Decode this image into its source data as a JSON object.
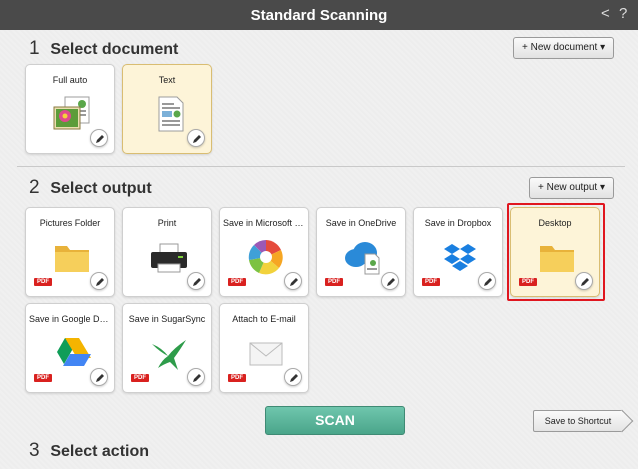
{
  "window": {
    "title": "Standard Scanning",
    "back_glyph": "<",
    "help_glyph": "?"
  },
  "section1": {
    "number": "1",
    "label": "Select document",
    "new_button": "+ New document ▾",
    "tiles": [
      {
        "label": "Full auto",
        "icon": "photo-icon",
        "selected": false
      },
      {
        "label": "Text",
        "icon": "text-document-icon",
        "selected": true
      }
    ]
  },
  "section2": {
    "number": "2",
    "label": "Select output",
    "new_button": "+ New output ▾",
    "tiles": [
      {
        "label": "Pictures Folder",
        "icon": "folder-icon",
        "badge": "PDF"
      },
      {
        "label": "Print",
        "icon": "printer-icon",
        "badge": ""
      },
      {
        "label": "Save in Microsoft S...",
        "icon": "microsoft-sharepoint-icon",
        "badge": "PDF"
      },
      {
        "label": "Save in OneDrive",
        "icon": "onedrive-icon",
        "badge": "PDF"
      },
      {
        "label": "Save in Dropbox",
        "icon": "dropbox-icon",
        "badge": "PDF"
      },
      {
        "label": "Desktop",
        "icon": "folder-icon",
        "badge": "PDF",
        "selected": true
      },
      {
        "label": "Save in Google Dri...",
        "icon": "google-drive-icon",
        "badge": "PDF"
      },
      {
        "label": "Save in SugarSync",
        "icon": "sugarsync-icon",
        "badge": "PDF"
      },
      {
        "label": "Attach to E-mail",
        "icon": "email-envelope-icon",
        "badge": "PDF"
      }
    ]
  },
  "section3": {
    "number": "3",
    "label": "Select action",
    "scan_button": "SCAN",
    "shortcut_button": "Save to Shortcut"
  },
  "colors": {
    "titlebar": "#4a4a4a",
    "scan": "#5bb59b",
    "selection_border": "#e0161f",
    "selected_tile": "#fdf4d8",
    "pdf_badge": "#d9211f"
  }
}
